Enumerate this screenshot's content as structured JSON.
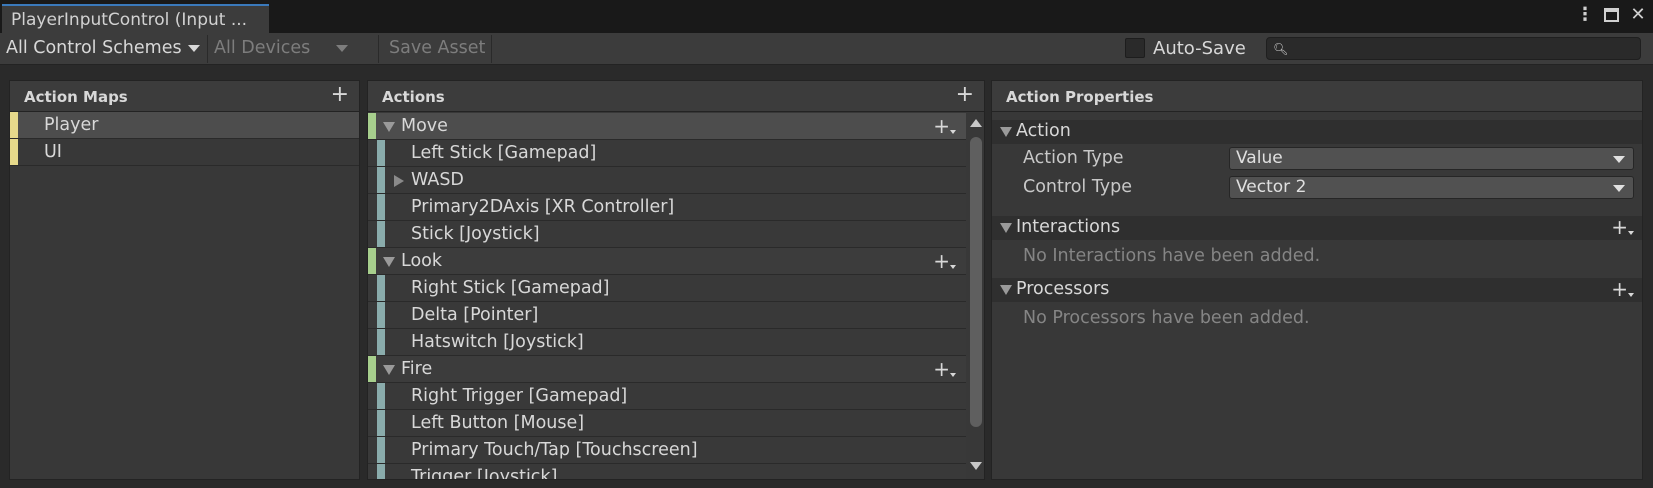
{
  "window": {
    "tab_title": "PlayerInputControl (Input ...",
    "controls": [
      "more-icon",
      "maximize-icon",
      "close-icon"
    ]
  },
  "toolbar": {
    "control_schemes": "All Control Schemes",
    "devices": "All Devices",
    "save_asset": "Save Asset",
    "auto_save_label": "Auto-Save",
    "auto_save_checked": false,
    "search_value": ""
  },
  "action_maps": {
    "header": "Action Maps",
    "items": [
      {
        "label": "Player",
        "selected": true
      },
      {
        "label": "UI",
        "selected": false
      }
    ]
  },
  "actions": {
    "header": "Actions",
    "groups": [
      {
        "name": "Move",
        "selected": true,
        "bindings": [
          {
            "label": "Left Stick [Gamepad]",
            "composite": false
          },
          {
            "label": "WASD",
            "composite": true
          },
          {
            "label": "Primary2DAxis [XR Controller]",
            "composite": false
          },
          {
            "label": "Stick [Joystick]",
            "composite": false
          }
        ]
      },
      {
        "name": "Look",
        "selected": false,
        "bindings": [
          {
            "label": "Right Stick [Gamepad]",
            "composite": false
          },
          {
            "label": "Delta [Pointer]",
            "composite": false
          },
          {
            "label": "Hatswitch [Joystick]",
            "composite": false
          }
        ]
      },
      {
        "name": "Fire",
        "selected": false,
        "bindings": [
          {
            "label": "Right Trigger [Gamepad]",
            "composite": false
          },
          {
            "label": "Left Button [Mouse]",
            "composite": false
          },
          {
            "label": "Primary Touch/Tap [Touchscreen]",
            "composite": false
          },
          {
            "label": "Trigger [Joystick]",
            "composite": false
          }
        ]
      }
    ]
  },
  "properties": {
    "header": "Action Properties",
    "action_section": "Action",
    "action_type_label": "Action Type",
    "action_type_value": "Value",
    "control_type_label": "Control Type",
    "control_type_value": "Vector 2",
    "interactions_section": "Interactions",
    "interactions_empty": "No Interactions have been added.",
    "processors_section": "Processors",
    "processors_empty": "No Processors have been added."
  },
  "colors": {
    "accent_tab": "#3a79bb",
    "map_stripe": "#e6d98b",
    "action_stripe": "#a7cf8d",
    "binding_stripe": "#8aacac"
  }
}
